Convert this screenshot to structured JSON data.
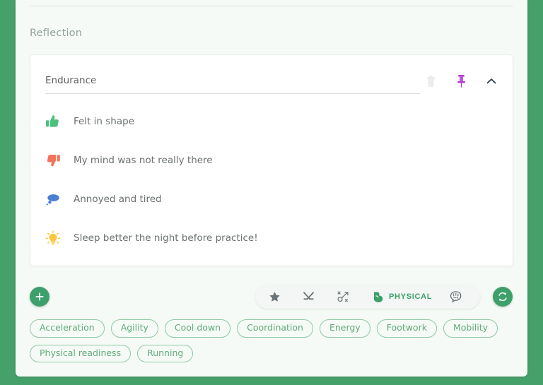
{
  "page": {
    "background_color": "#45a06a",
    "panel_color": "#f5faf6",
    "accent_color": "#3da06b"
  },
  "section": {
    "title": "Reflection"
  },
  "reflection_card": {
    "title_input": {
      "value": "Endurance",
      "placeholder": "Title"
    },
    "actions": [
      {
        "name": "delete-button",
        "icon": "trash-icon",
        "color": "#e9ebea"
      },
      {
        "name": "pin-button",
        "icon": "pin-icon",
        "color": "#b43fd0"
      },
      {
        "name": "collapse-button",
        "icon": "chevron-up-icon",
        "color": "#3a4a55"
      }
    ],
    "items": [
      {
        "icon": "thumbs-up-icon",
        "color": "#4ec07e",
        "text": "Felt in shape"
      },
      {
        "icon": "thumbs-down-icon",
        "color": "#f4735a",
        "text": "My mind was not really there"
      },
      {
        "icon": "thought-bubble-icon",
        "color": "#4a7fd1",
        "text": "Annoyed and tired"
      },
      {
        "icon": "lightbulb-icon",
        "color": "#fcc63f",
        "text": "Sleep better the night before practice!"
      }
    ]
  },
  "controls": {
    "add_button": {
      "icon": "plus-icon",
      "label": ""
    },
    "sync_button": {
      "icon": "refresh-icon",
      "label": ""
    },
    "toolbar": [
      {
        "icon": "star-icon",
        "label": "",
        "active": false
      },
      {
        "icon": "hockey-sticks-icon",
        "label": "",
        "active": false
      },
      {
        "icon": "tactics-icon",
        "label": "",
        "active": false
      },
      {
        "icon": "bicep-icon",
        "label": "PHYSICAL",
        "active": true
      },
      {
        "icon": "brain-icon",
        "label": "",
        "active": false
      }
    ]
  },
  "tags": [
    "Acceleration",
    "Agility",
    "Cool down",
    "Coordination",
    "Energy",
    "Footwork",
    "Mobility",
    "Physical readiness",
    "Running"
  ]
}
